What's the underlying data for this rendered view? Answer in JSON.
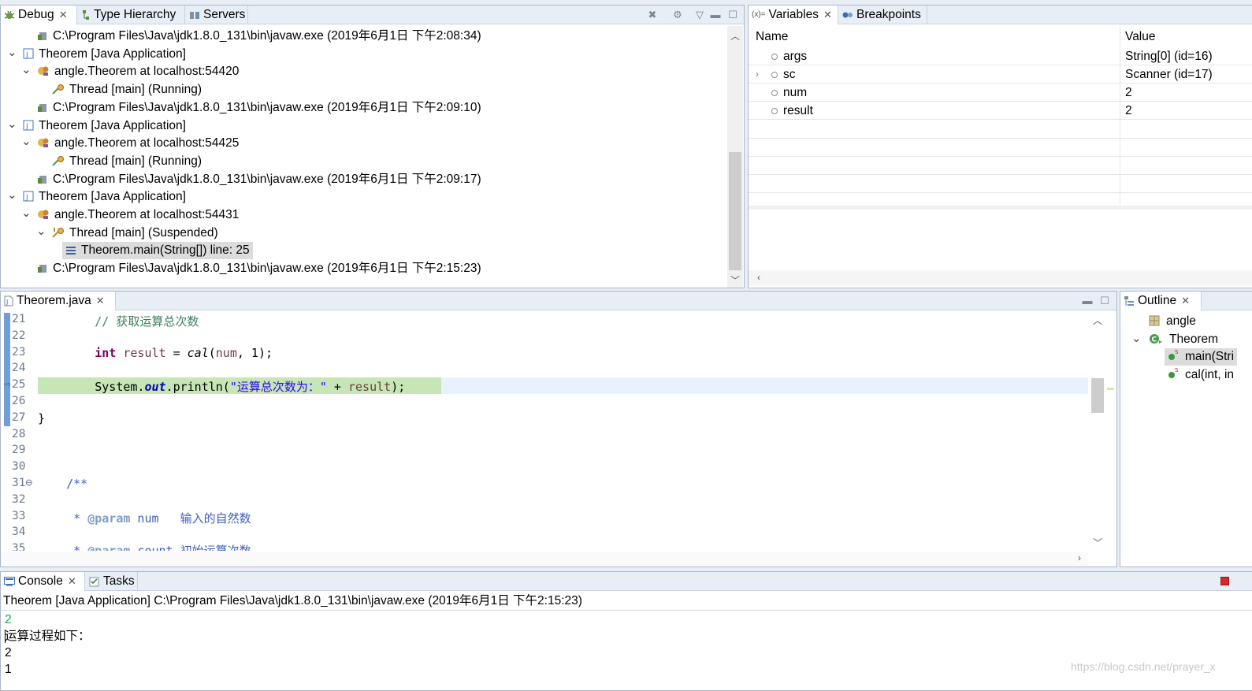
{
  "debug": {
    "tabs": [
      {
        "label": "Debug",
        "icon": "bug-icon",
        "active": true
      },
      {
        "label": "Type Hierarchy",
        "icon": "hierarchy-icon"
      },
      {
        "label": "Servers",
        "icon": "servers-icon"
      }
    ],
    "tree": [
      {
        "level": 2,
        "kind": "process",
        "text": "C:\\Program Files\\Java\\jdk1.8.0_131\\bin\\javaw.exe (2019年6月1日 下午2:08:34)"
      },
      {
        "level": 0,
        "kind": "app",
        "twisty": "open",
        "text": "Theorem [Java Application]"
      },
      {
        "level": 1,
        "kind": "vm",
        "twisty": "open",
        "text": "angle.Theorem at localhost:54420"
      },
      {
        "level": 2,
        "kind": "thread-running",
        "text": "Thread [main] (Running)"
      },
      {
        "level": 2,
        "kind": "process",
        "text": "C:\\Program Files\\Java\\jdk1.8.0_131\\bin\\javaw.exe (2019年6月1日 下午2:09:10)"
      },
      {
        "level": 0,
        "kind": "app",
        "twisty": "open",
        "text": "Theorem [Java Application]"
      },
      {
        "level": 1,
        "kind": "vm",
        "twisty": "open",
        "text": "angle.Theorem at localhost:54425"
      },
      {
        "level": 2,
        "kind": "thread-running",
        "text": "Thread [main] (Running)"
      },
      {
        "level": 2,
        "kind": "process",
        "text": "C:\\Program Files\\Java\\jdk1.8.0_131\\bin\\javaw.exe (2019年6月1日 下午2:09:17)"
      },
      {
        "level": 0,
        "kind": "app",
        "twisty": "open",
        "text": "Theorem [Java Application]"
      },
      {
        "level": 1,
        "kind": "vm",
        "twisty": "open",
        "text": "angle.Theorem at localhost:54431"
      },
      {
        "level": 2,
        "kind": "thread-suspended",
        "twisty": "open",
        "text": "Thread [main] (Suspended)"
      },
      {
        "level": 3,
        "kind": "frame",
        "selected": true,
        "text": "Theorem.main(String[]) line: 25"
      },
      {
        "level": 2,
        "kind": "process",
        "text": "C:\\Program Files\\Java\\jdk1.8.0_131\\bin\\javaw.exe (2019年6月1日 下午2:15:23)"
      }
    ]
  },
  "variables": {
    "tabs": [
      {
        "label": "Variables",
        "icon": "variables-icon",
        "active": true
      },
      {
        "label": "Breakpoints",
        "icon": "breakpoints-icon"
      }
    ],
    "columns": [
      "Name",
      "Value"
    ],
    "rows": [
      {
        "name": "args",
        "value": "String[0]  (id=16)",
        "expandable": false
      },
      {
        "name": "sc",
        "value": "Scanner  (id=17)",
        "expandable": true
      },
      {
        "name": "num",
        "value": "2",
        "expandable": false
      },
      {
        "name": "result",
        "value": "2",
        "expandable": false
      }
    ]
  },
  "editor": {
    "tab": "Theorem.java",
    "lines": [
      {
        "n": "21",
        "html": "        <span class='cm'>// 获取运算总次数</span>"
      },
      {
        "n": "22",
        "html": ""
      },
      {
        "n": "23",
        "html": "        <span class='kw'>int</span> <span class='var'>result</span> = <span class='it'>cal</span>(<span class='var'>num</span>, 1);"
      },
      {
        "n": "24",
        "html": ""
      },
      {
        "n": "25",
        "html": "        System.<span class='fld'>out</span>.println(<span class='st'>\"运算总次数为：\"</span> + <span class='var'>result</span>);",
        "current": true
      },
      {
        "n": "26",
        "html": ""
      },
      {
        "n": "27",
        "html": "}"
      },
      {
        "n": "28",
        "html": ""
      },
      {
        "n": "29",
        "html": ""
      },
      {
        "n": "30",
        "html": ""
      },
      {
        "n": "31⊖",
        "html": "    <span class='jd'>/**</span>"
      },
      {
        "n": "32",
        "html": ""
      },
      {
        "n": "33",
        "html": "     <span class='jd'>* </span><span class='tag'>@param</span><span class='jd'> num   输入的自然数</span>"
      },
      {
        "n": "34",
        "html": ""
      },
      {
        "n": "35",
        "html": "     <span class='jd'>* </span><span class='tag'>@param</span><span class='jd'> count 初始运算次数</span>"
      }
    ]
  },
  "outline": {
    "tab": "Outline",
    "items": [
      {
        "level": 0,
        "kind": "package",
        "text": "angle"
      },
      {
        "level": 0,
        "kind": "class",
        "twisty": "open",
        "text": "Theorem"
      },
      {
        "level": 1,
        "kind": "method",
        "selected": true,
        "text": "main(Stri"
      },
      {
        "level": 1,
        "kind": "method",
        "text": "cal(int, in"
      }
    ]
  },
  "console": {
    "tabs": [
      {
        "label": "Console",
        "icon": "console-icon",
        "active": true
      },
      {
        "label": "Tasks",
        "icon": "tasks-icon"
      }
    ],
    "header": "Theorem [Java Application] C:\\Program Files\\Java\\jdk1.8.0_131\\bin\\javaw.exe (2019年6月1日 下午2:15:23)",
    "lines": [
      {
        "text": "2",
        "input": true
      },
      {
        "text": "运算过程如下："
      },
      {
        "text": "2"
      },
      {
        "text": "1"
      }
    ],
    "watermark": "https://blog.csdn.net/prayer_x"
  }
}
